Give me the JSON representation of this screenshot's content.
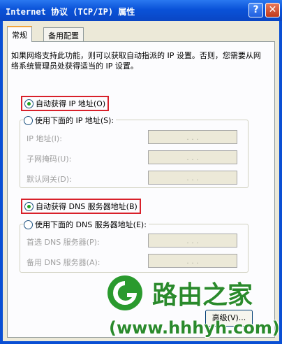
{
  "window": {
    "title": "Internet 协议 (TCP/IP) 属性",
    "help_label": "?",
    "close_label": "✕"
  },
  "tabs": [
    {
      "label": "常规",
      "active": true
    },
    {
      "label": "备用配置",
      "active": false
    }
  ],
  "description": "如果网络支持此功能，则可以获取自动指派的 IP 设置。否则，您需要从网络系统管理员处获得适当的 IP 设置。",
  "ip": {
    "auto_label": "自动获得 IP 地址(O)",
    "manual_label": "使用下面的 IP 地址(S):",
    "fields": [
      {
        "label": "IP 地址(I):",
        "value": ". . ."
      },
      {
        "label": "子网掩码(U):",
        "value": ". . ."
      },
      {
        "label": "默认网关(D):",
        "value": ". . ."
      }
    ]
  },
  "dns": {
    "auto_label": "自动获得 DNS 服务器地址(B)",
    "manual_label": "使用下面的 DNS 服务器地址(E):",
    "fields": [
      {
        "label": "首选 DNS 服务器(P):",
        "value": ". . ."
      },
      {
        "label": "备用 DNS 服务器(A):",
        "value": ". . ."
      }
    ]
  },
  "buttons": {
    "advanced_label": "高级(V)..."
  },
  "watermark": {
    "brand": "路由之家",
    "url": "(www.hhhyh.com)"
  },
  "colors": {
    "titlebar": "#0a52d8",
    "highlight": "#d8202a",
    "watermark": "#2a8a2c"
  }
}
